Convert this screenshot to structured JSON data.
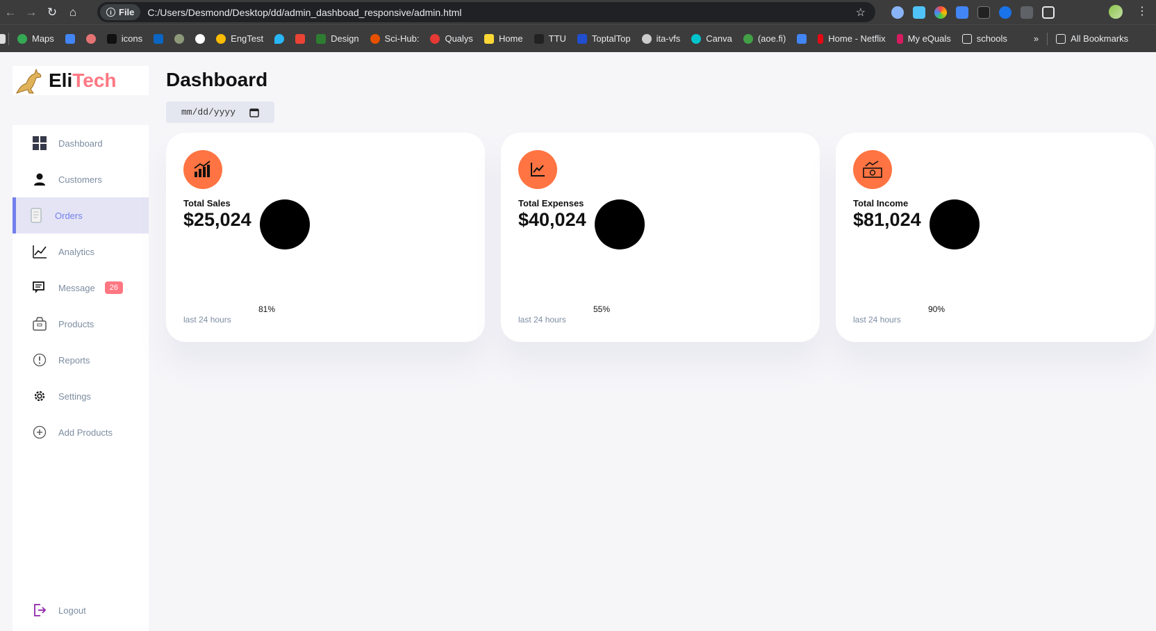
{
  "browser": {
    "file_chip": "File",
    "url": "C:/Users/Desmond/Desktop/dd/admin_dashboad_responsive/admin.html",
    "bookmarks": [
      "Maps",
      "icons",
      "EngTest",
      "Design",
      "Sci-Hub:",
      "Qualys",
      "Home",
      "TTU",
      "ToptalTop",
      "ita-vfs",
      "Canva",
      "(aoe.fi)",
      "Home - Netflix",
      "My eQuals",
      "schools"
    ],
    "all_bookmarks": "All Bookmarks"
  },
  "logo": {
    "part1": "Eli",
    "part2": "Tech"
  },
  "sidebar": {
    "items": [
      {
        "label": "Dashboard",
        "icon": "grid-icon"
      },
      {
        "label": "Customers",
        "icon": "person-icon"
      },
      {
        "label": "Orders",
        "icon": "receipt-icon"
      },
      {
        "label": "Analytics",
        "icon": "chart-icon"
      },
      {
        "label": "Message",
        "icon": "message-icon",
        "badge": "26"
      },
      {
        "label": "Products",
        "icon": "box-icon"
      },
      {
        "label": "Reports",
        "icon": "report-icon"
      },
      {
        "label": "Settings",
        "icon": "gear-icon"
      },
      {
        "label": "Add Products",
        "icon": "add-icon"
      },
      {
        "label": "Logout",
        "icon": "logout-icon"
      }
    ]
  },
  "main": {
    "title": "Dashboard",
    "date_placeholder": "mm/dd/yyyy",
    "cards": [
      {
        "label": "Total Sales",
        "value": "$25,024",
        "percent": "81%",
        "sub": "last 24 hours",
        "icon": "bar-chart-icon"
      },
      {
        "label": "Total Expenses",
        "value": "$40,024",
        "percent": "55%",
        "sub": "last 24 hours",
        "icon": "line-chart-icon"
      },
      {
        "label": "Total Income",
        "value": "$81,024",
        "percent": "90%",
        "sub": "last 24 hours",
        "icon": "money-icon"
      }
    ]
  },
  "colors": {
    "accent": "#ff7442",
    "primary": "#7380ec",
    "danger": "#ff7782",
    "background": "#f6f6f9"
  }
}
